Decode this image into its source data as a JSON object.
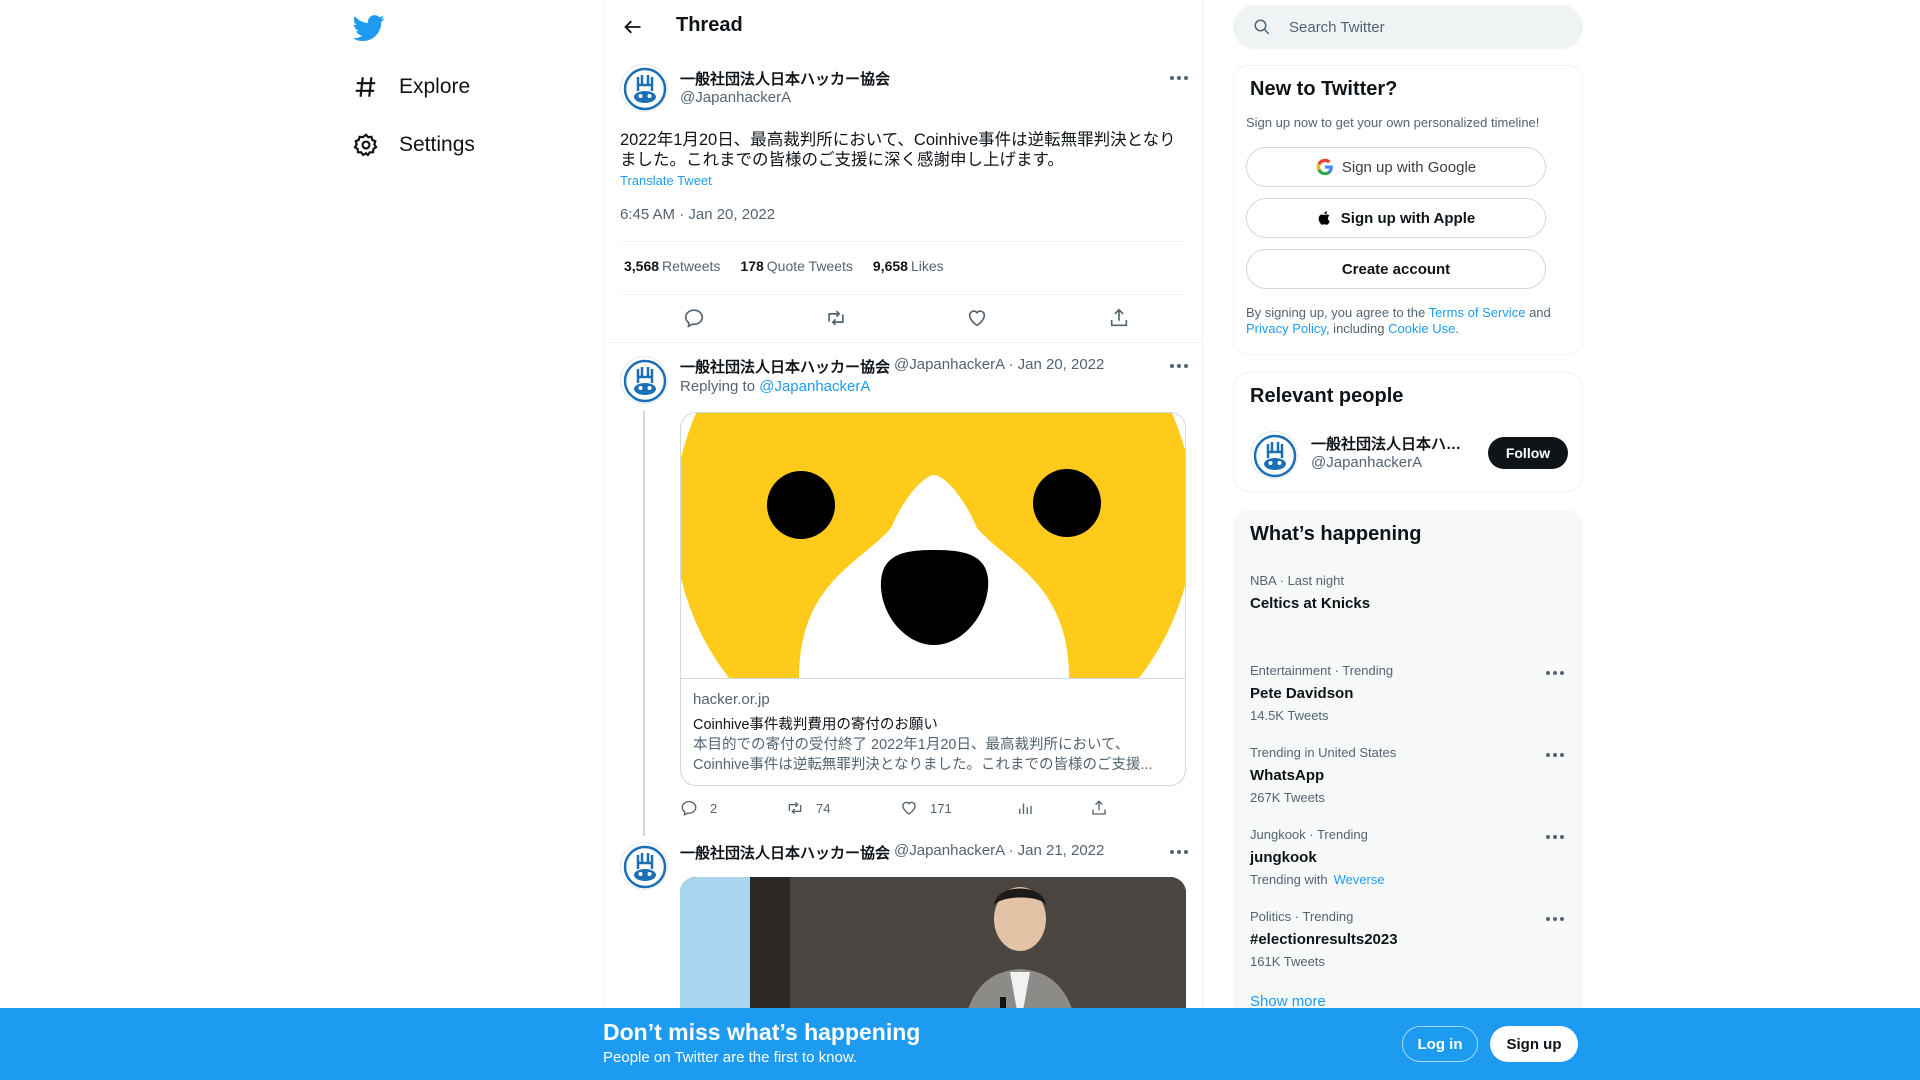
{
  "nav": {
    "logo": "twitter-bird-icon",
    "items": [
      {
        "label": "Explore",
        "icon": "hashtag-icon"
      },
      {
        "label": "Settings",
        "icon": "gear-icon"
      }
    ]
  },
  "header": {
    "title": "Thread"
  },
  "main_tweet": {
    "name": "一般社団法人日本ハッカー協会",
    "handle": "@JapanhackerA",
    "text": "2022年1月20日、最高裁判所において、Coinhive事件は逆転無罪判決となりました。これまでの皆様のご支援に深く感謝申し上げます。",
    "translate": "Translate Tweet",
    "time": "6:45 AM · Jan 20, 2022",
    "stats": {
      "retweets": "3,568",
      "retweets_label": "Retweets",
      "quotes": "178",
      "quotes_label": "Quote Tweets",
      "likes": "9,658",
      "likes_label": "Likes"
    }
  },
  "reply1": {
    "name": "一般社団法人日本ハッカー協会",
    "meta": "@JapanhackerA · Jan 20, 2022",
    "replying_prefix": "Replying to",
    "replying_to": "@JapanhackerA",
    "card": {
      "domain": "hacker.or.jp",
      "title": "Coinhive事件裁判費用の寄付のお願い",
      "description": "本目的での寄付の受付終了 2022年1月20日、最高裁判所において、Coinhive事件は逆転無罪判決となりました。これまでの皆様のご支援..."
    },
    "actions": {
      "replies": "2",
      "retweets": "74",
      "likes": "171"
    }
  },
  "reply2": {
    "name": "一般社団法人日本ハッカー協会",
    "meta": "@JapanhackerA · Jan 21, 2022"
  },
  "search": {
    "placeholder": "Search Twitter"
  },
  "signup_panel": {
    "title": "New to Twitter?",
    "subtitle": "Sign up now to get your own personalized timeline!",
    "google": "Sign up with Google",
    "apple": "Sign up with Apple",
    "create": "Create account",
    "legal_1": "By signing up, you agree to the",
    "terms": "Terms of Service",
    "legal_2": "and",
    "privacy": "Privacy Policy",
    "legal_3": ", including",
    "cookie": "Cookie Use",
    "legal_4": "."
  },
  "people": {
    "title": "Relevant people",
    "name": "一般社団法人日本ハッカー協会",
    "handle": "@JapanhackerA",
    "follow": "Follow"
  },
  "trends": {
    "title": "What’s happening",
    "items": [
      {
        "context": "NBA · Last night",
        "title": "Celtics at Knicks",
        "count": ""
      },
      {
        "context": "Entertainment · Trending",
        "title": "Pete Davidson",
        "count": "14.5K Tweets"
      },
      {
        "context": "Trending in United States",
        "title": "WhatsApp",
        "count": "267K Tweets"
      },
      {
        "context": "Jungkook · Trending",
        "title": "jungkook",
        "count": "Trending with",
        "link": "Weverse"
      },
      {
        "context": "Politics · Trending",
        "title": "#electionresults2023",
        "count": "161K Tweets"
      }
    ],
    "show_more": "Show more"
  },
  "banner": {
    "title": "Don’t miss what’s happening",
    "subtitle": "People on Twitter are the first to know.",
    "login": "Log in",
    "signup": "Sign up"
  },
  "colors": {
    "accent": "#1d9bf0",
    "text": "#0f1419",
    "secondary": "#536471"
  }
}
